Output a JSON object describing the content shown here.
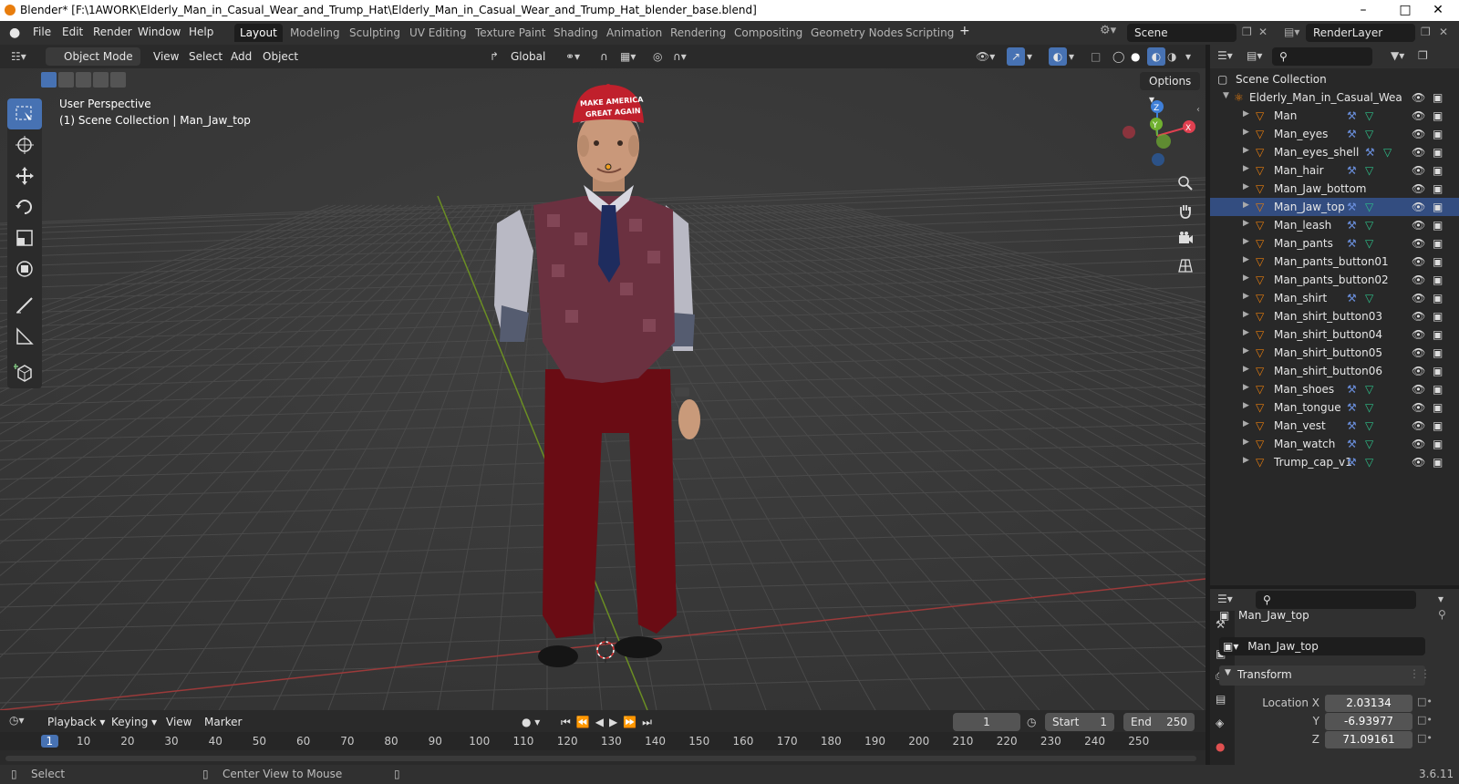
{
  "window": {
    "title": "Blender* [F:\\1AWORK\\Elderly_Man_in_Casual_Wear_and_Trump_Hat\\Elderly_Man_in_Casual_Wear_and_Trump_Hat_blender_base.blend]"
  },
  "menu": [
    "File",
    "Edit",
    "Render",
    "Window",
    "Help"
  ],
  "workspaces": [
    "Layout",
    "Modeling",
    "Sculpting",
    "UV Editing",
    "Texture Paint",
    "Shading",
    "Animation",
    "Rendering",
    "Compositing",
    "Geometry Nodes",
    "Scripting"
  ],
  "active_workspace": "Layout",
  "scene": {
    "name": "Scene",
    "view_layer": "RenderLayer"
  },
  "viewport_header": {
    "mode": "Object Mode",
    "menus": [
      "View",
      "Select",
      "Add",
      "Object"
    ],
    "transform_orientation": "Global",
    "options_label": "Options"
  },
  "viewport": {
    "overlay_line1": "User Perspective",
    "overlay_line2": "(1) Scene Collection | Man_Jaw_top",
    "hat_text_1": "MAKE AMERICA",
    "hat_text_2": "GREAT AGAIN"
  },
  "gizmo": {
    "x": "X",
    "y": "Y",
    "z": "Z"
  },
  "outliner": {
    "root": "Scene Collection",
    "collection": "Elderly_Man_in_Casual_Wea",
    "items": [
      "Man",
      "Man_eyes",
      "Man_eyes_shell",
      "Man_hair",
      "Man_Jaw_bottom",
      "Man_Jaw_top",
      "Man_leash",
      "Man_pants",
      "Man_pants_button01",
      "Man_pants_button02",
      "Man_shirt",
      "Man_shirt_button03",
      "Man_shirt_button04",
      "Man_shirt_button05",
      "Man_shirt_button06",
      "Man_shoes",
      "Man_tongue",
      "Man_vest",
      "Man_watch",
      "Trump_cap_v1"
    ],
    "selected": "Man_Jaw_top"
  },
  "properties": {
    "object_name": "Man_Jaw_top",
    "datablock": "Man_Jaw_top",
    "panel": "Transform",
    "location_label": "Location X",
    "y_label": "Y",
    "z_label": "Z",
    "location": [
      "2.03134",
      "-6.93977",
      "71.09161"
    ]
  },
  "timeline": {
    "menus": [
      "Playback",
      "Keying",
      "View",
      "Marker"
    ],
    "current_frame": "1",
    "start_label": "Start",
    "start": "1",
    "end_label": "End",
    "end": "250",
    "ruler": [
      "1",
      "10",
      "20",
      "30",
      "40",
      "50",
      "60",
      "70",
      "80",
      "90",
      "100",
      "110",
      "120",
      "130",
      "140",
      "150",
      "160",
      "170",
      "180",
      "190",
      "200",
      "210",
      "220",
      "230",
      "240",
      "250"
    ]
  },
  "statusbar": {
    "select": "Select",
    "center": "Center View to Mouse",
    "version": "3.6.11"
  },
  "colors": {
    "accent": "#4772b3",
    "object_orange": "#e87d0d",
    "header": "#303030",
    "viewport": "#393939"
  }
}
